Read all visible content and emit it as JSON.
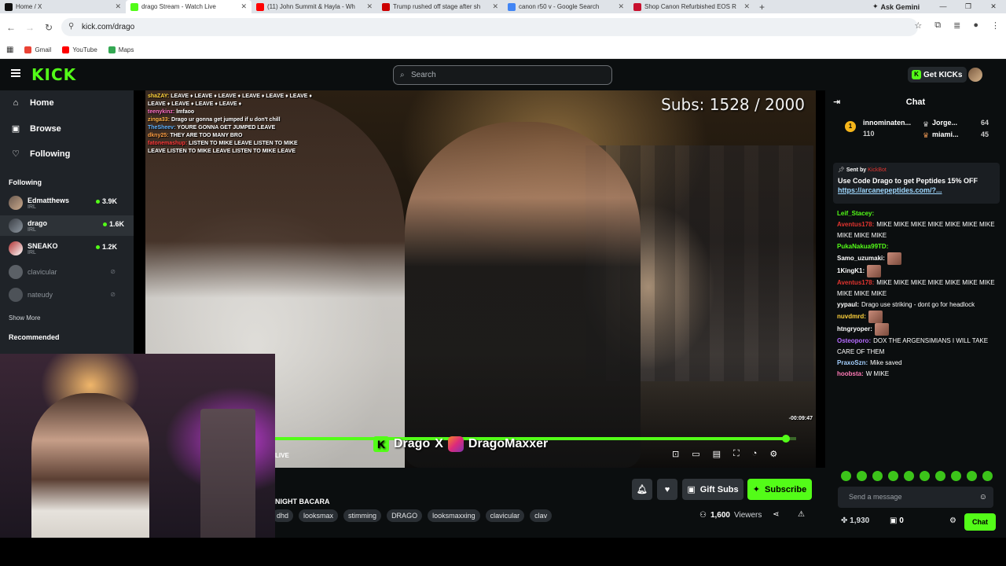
{
  "browser": {
    "tabs": [
      {
        "title": "Home / X",
        "color": "#111111"
      },
      {
        "title": "drago Stream - Watch Live",
        "color": "#53fc18"
      },
      {
        "title": "(11) John Summit & Hayla - Wh",
        "color": "#ff0000"
      },
      {
        "title": "Trump rushed off stage after sh",
        "color": "#cc0000"
      },
      {
        "title": "canon r50 v - Google Search",
        "color": "#4285f4"
      },
      {
        "title": "Shop Canon Refurbished EOS R",
        "color": "#c8102e"
      }
    ],
    "ask_gemini": "Ask Gemini",
    "url": "kick.com/drago",
    "bookmarks": [
      "Gmail",
      "YouTube",
      "Maps"
    ]
  },
  "header": {
    "logo": "KICK",
    "search_placeholder": "Search",
    "get_kicks": "Get KICKs"
  },
  "sidebar": {
    "nav": [
      "Home",
      "Browse",
      "Following"
    ],
    "following_heading": "Following",
    "channels": [
      {
        "name": "Edmatthews",
        "category": "IRL",
        "viewers": "3.9K"
      },
      {
        "name": "drago",
        "category": "IRL",
        "viewers": "1.6K"
      },
      {
        "name": "SNEAKO",
        "category": "IRL",
        "viewers": "1.2K"
      },
      {
        "name": "clavicular",
        "category": "",
        "viewers": ""
      },
      {
        "name": "nateudy",
        "category": "",
        "viewers": ""
      }
    ],
    "show_more": "Show More",
    "recommended_heading": "Recommended"
  },
  "video": {
    "subs_overlay": "Subs: 1528 / 2000",
    "overlay_chat": [
      {
        "user": "shaZAY:",
        "text": "LEAVE ♦ LEAVE ♦ LEAVE ♦ LEAVE ♦ LEAVE ♦ LEAVE ♦ LEAVE ♦ LEAVE ♦ LEAVE ♦ LEAVE ♦",
        "color": "#ffd23c"
      },
      {
        "user": "teenykinz:",
        "text": "lmfaoo",
        "color": "#ff6ec7"
      },
      {
        "user": "zinga33:",
        "text": "Drago ur gonna get jumped if u don't chill",
        "color": "#ffb347"
      },
      {
        "user": "TheSheev:",
        "text": "YOURE GONNA GET JUMPED LEAVE",
        "color": "#5fb3ff"
      },
      {
        "user": "dkny25:",
        "text": "THEY ARE TOO MANY BRO",
        "color": "#ff9f43"
      },
      {
        "user": "fatonemashup:",
        "text": "LISTEN TO MIKE LEAVE LISTEN TO MIKE LEAVE LISTEN TO MIKE LEAVE LISTEN TO MIKE LEAVE",
        "color": "#ff3b3b"
      }
    ],
    "brand_left": "Drago",
    "brand_x": "X",
    "brand_right": "DragoMaxxer",
    "time_left": "-00:09:47",
    "progress": 0.98,
    "live_label": "LIVE"
  },
  "stream": {
    "title": "NIGHT BACARA",
    "tags": [
      "dhd",
      "looksmax",
      "stimming",
      "DRAGO",
      "looksmaxxing",
      "clavicular",
      "clav"
    ],
    "gift_subs": "Gift Subs",
    "subscribe": "Subscribe",
    "viewers_count": "1,600",
    "viewers_label": "Viewers"
  },
  "chat": {
    "title": "Chat",
    "leaders": [
      {
        "name": "innominaten...",
        "value": "110"
      },
      {
        "name": "Jorge...",
        "value": "64"
      },
      {
        "name": "miami...",
        "value": "45"
      }
    ],
    "pinned": {
      "sent_by": "Sent by",
      "sender": "KickBot",
      "message": "Use Code Drago to get Peptides 15% OFF",
      "link": "https://arcanepeptides.com/?..."
    },
    "messages": [
      {
        "user": "Leif_Stacey:",
        "text": "",
        "color": "#53fc18",
        "emote": false
      },
      {
        "user": "Aventus178:",
        "text": "MIKE MIKE MIKE MIKE MIKE MIKE MIKE MIKE MIKE MIKE",
        "color": "#e0342f",
        "emote": false
      },
      {
        "user": "PukaNakua99TD:",
        "text": "",
        "color": "#53fc18",
        "emote": false
      },
      {
        "user": "Samo_uzumaki:",
        "text": "",
        "color": "#ffffff",
        "emote": true
      },
      {
        "user": "1KingK1:",
        "text": "",
        "color": "#ffffff",
        "emote": true
      },
      {
        "user": "Aventus178:",
        "text": "MIKE MIKE MIKE MIKE MIKE MIKE MIKE MIKE MIKE MIKE",
        "color": "#e0342f",
        "emote": false
      },
      {
        "user": "yypaul:",
        "text": "Drago use striking - dont go for headlock",
        "color": "#ffffff",
        "emote": false
      },
      {
        "user": "nuvdmrd:",
        "text": "",
        "color": "#ffd23c",
        "emote": true
      },
      {
        "user": "htngryoper:",
        "text": "",
        "color": "#ffffff",
        "emote": true
      },
      {
        "user": "Osteoporo:",
        "text": "DOX THE ARGENSIMIANS I WILL TAKE CARE OF THEM",
        "color": "#b56bff",
        "emote": false
      },
      {
        "user": "PraxoSzn:",
        "text": "Mike saved",
        "color": "#a4d0ff",
        "emote": false
      },
      {
        "user": "hoobsta:",
        "text": "W MIKE",
        "color": "#ff7ab6",
        "emote": false
      }
    ],
    "send_placeholder": "Send a message",
    "points": "1,930",
    "gifts": "0",
    "chat_button": "Chat"
  }
}
